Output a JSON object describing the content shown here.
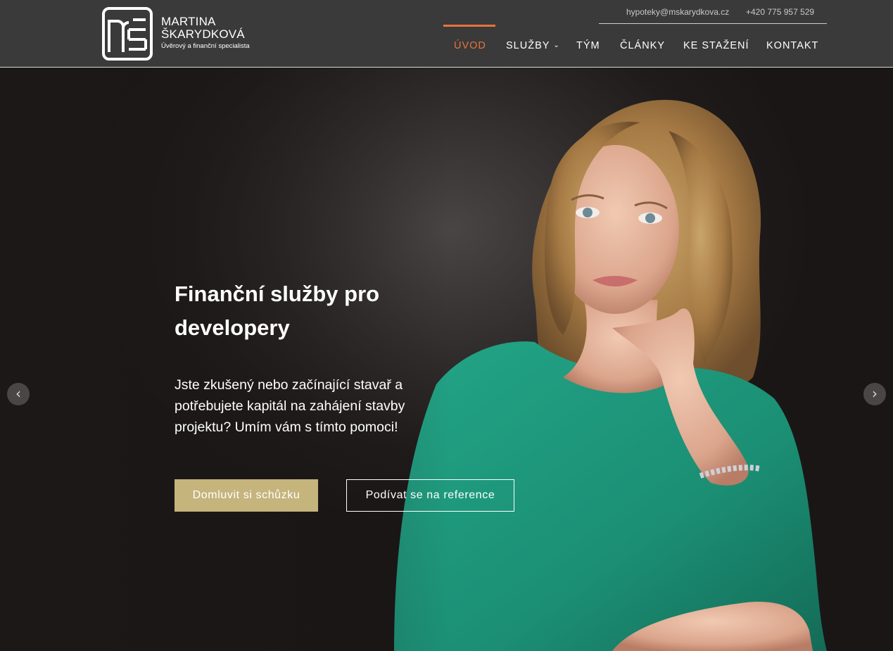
{
  "brand": {
    "name_line1": "MARTINA",
    "name_line2": "ŠKARYDKOVÁ",
    "tagline": "Úvěrový a finanční specialista",
    "logo_icon": "ms-monogram-logo"
  },
  "contact": {
    "email": "hypoteky@mskarydkova.cz",
    "phone": "+420 775 957 529"
  },
  "nav": {
    "items": [
      {
        "label": "ÚVOD",
        "active": true
      },
      {
        "label": "SLUŽBY",
        "has_dropdown": true,
        "dropdown_icon": "chevron-down-icon"
      },
      {
        "label": "TÝM"
      },
      {
        "label": "ČLÁNKY"
      },
      {
        "label": "KE STAŽENÍ"
      },
      {
        "label": "KONTAKT"
      }
    ]
  },
  "hero": {
    "title": "Finanční služby pro developery",
    "text": "Jste zkušený nebo začínající stavař a potřebujete kapitál na zahájení stavby projektu? Umím vám s tímto pomoci!",
    "primary_button": "Domluvit si schůzku",
    "secondary_button": "Podívat se na reference",
    "prev_icon": "chevron-left-icon",
    "next_icon": "chevron-right-icon",
    "prev_glyph": "‹",
    "next_glyph": "›"
  },
  "colors": {
    "header_bg": "#3a3a3a",
    "accent": "#e8733c",
    "button_gold": "#c5b47c",
    "shirt": "#1f9a7e"
  }
}
